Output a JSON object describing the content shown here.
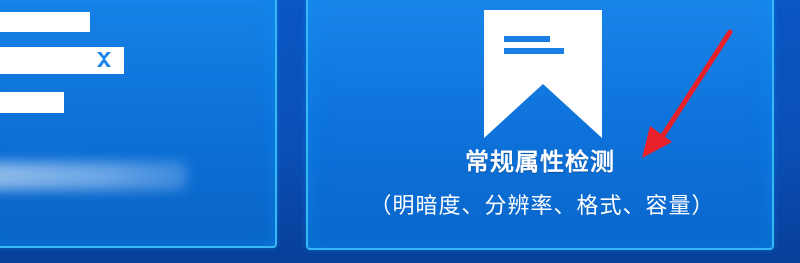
{
  "cards": {
    "feature": {
      "title": "常规属性检测",
      "subtitle": "（明暗度、分辨率、格式、容量）",
      "icon": "bookmark-document-icon"
    }
  },
  "colors": {
    "background": "#0b4fb6",
    "card": "#0d72da",
    "card_border": "#37b7f3",
    "arrow": "#e8202a"
  }
}
